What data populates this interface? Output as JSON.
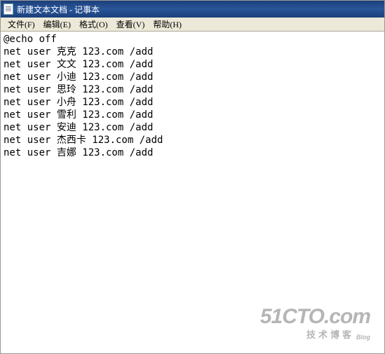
{
  "titlebar": {
    "title": "新建文本文档 - 记事本"
  },
  "menubar": {
    "items": [
      {
        "label": "文件(F)"
      },
      {
        "label": "编辑(E)"
      },
      {
        "label": "格式(O)"
      },
      {
        "label": "查看(V)"
      },
      {
        "label": "帮助(H)"
      }
    ]
  },
  "content": {
    "lines": [
      "@echo off",
      "net user 克克 123.com /add",
      "net user 文文 123.com /add",
      "net user 小迪 123.com /add",
      "net user 思玲 123.com /add",
      "net user 小舟 123.com /add",
      "net user 雪利 123.com /add",
      "net user 安迪 123.com /add",
      "net user 杰西卡 123.com /add",
      "net user 吉娜 123.com /add"
    ]
  },
  "watermark": {
    "big": "51CTO.com",
    "sub": "技术博客",
    "blog": "Blog"
  }
}
